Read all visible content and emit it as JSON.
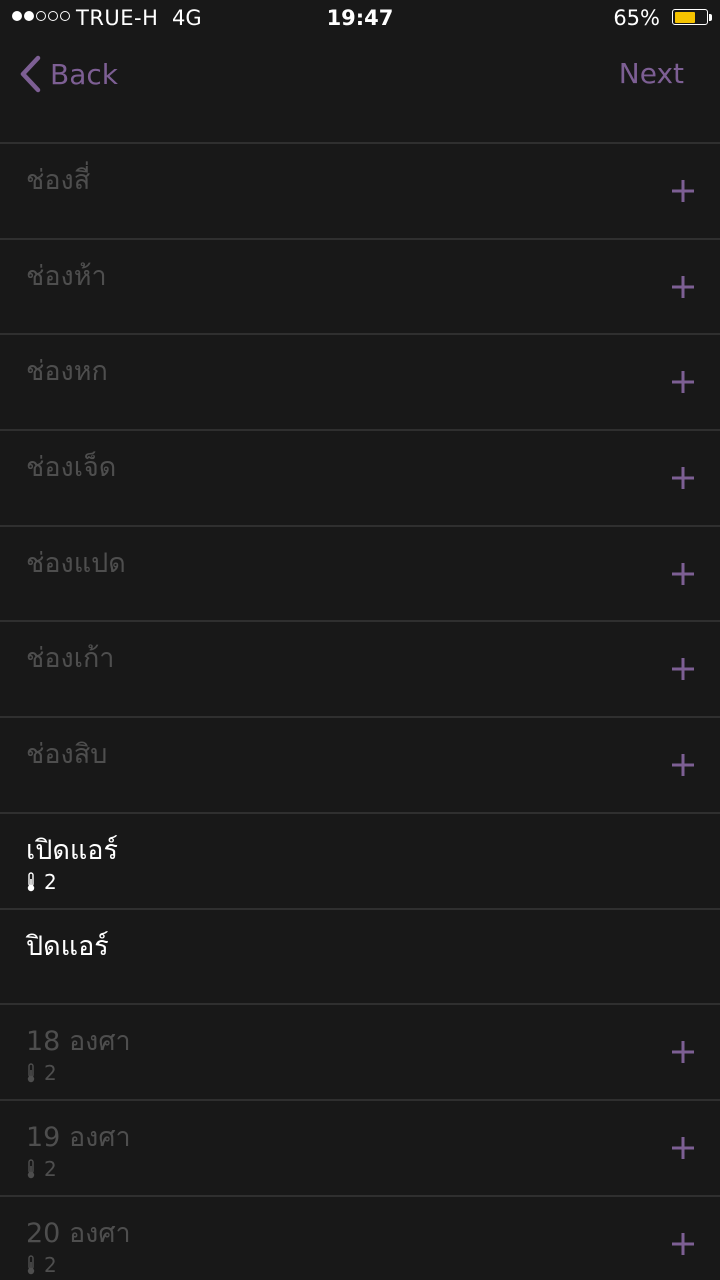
{
  "status_bar": {
    "carrier": "TRUE-H",
    "network": "4G",
    "time": "19:47",
    "battery_percent": "65%",
    "battery_level": 0.65,
    "signal_filled": 2,
    "signal_total": 5,
    "battery_color": "#f5c300"
  },
  "nav": {
    "back_label": "Back",
    "next_label": "Next"
  },
  "colors": {
    "accent": "#7d5f94",
    "background": "#181818",
    "dim_text": "#4e4e4e",
    "active_text": "#ffffff"
  },
  "rows": [
    {
      "title": "ช่องสี่",
      "sub": "",
      "active": false,
      "add": true
    },
    {
      "title": "ช่องห้า",
      "sub": "",
      "active": false,
      "add": true
    },
    {
      "title": "ช่องหก",
      "sub": "",
      "active": false,
      "add": true
    },
    {
      "title": "ช่องเจ็ด",
      "sub": "",
      "active": false,
      "add": true
    },
    {
      "title": "ช่องแปด",
      "sub": "",
      "active": false,
      "add": true
    },
    {
      "title": "ช่องเก้า",
      "sub": "",
      "active": false,
      "add": true
    },
    {
      "title": "ช่องสิบ",
      "sub": "",
      "active": false,
      "add": true
    },
    {
      "title": "เปิดแอร์",
      "sub": "2",
      "active": true,
      "add": false
    },
    {
      "title": "ปิดแอร์",
      "sub": "",
      "active": true,
      "add": false
    },
    {
      "title": "18 องศา",
      "sub": "2",
      "active": false,
      "add": true
    },
    {
      "title": "19 องศา",
      "sub": "2",
      "active": false,
      "add": true
    },
    {
      "title": "20 องศา",
      "sub": "2",
      "active": false,
      "add": true
    }
  ]
}
